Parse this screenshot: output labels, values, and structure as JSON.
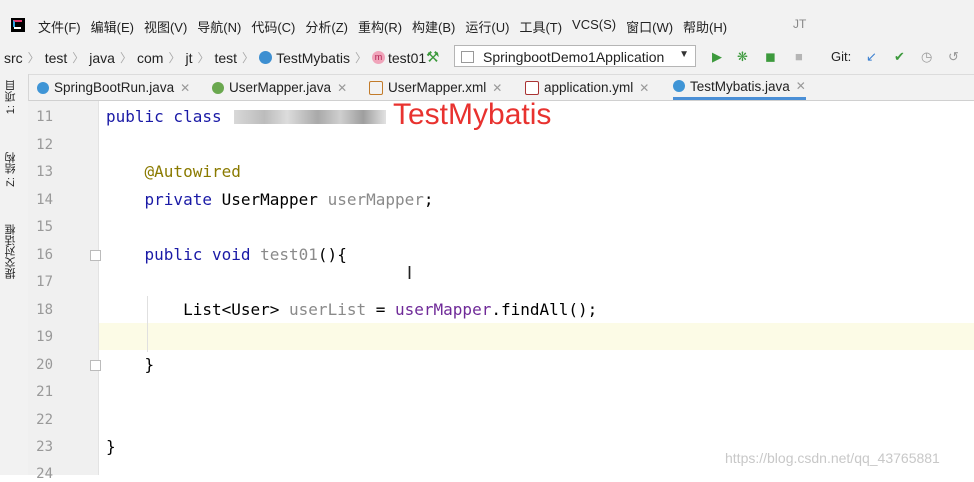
{
  "menu": {
    "items": [
      "文件(F)",
      "编辑(E)",
      "视图(V)",
      "导航(N)",
      "代码(C)",
      "分析(Z)",
      "重构(R)",
      "构建(B)",
      "运行(U)",
      "工具(T)",
      "VCS(S)",
      "窗口(W)",
      "帮助(H)"
    ],
    "user": "JT"
  },
  "breadcrumbs": [
    "src",
    "test",
    "java",
    "com",
    "jt",
    "test",
    "TestMybatis",
    "test01"
  ],
  "run_config": "SpringbootDemo1Application",
  "git_label": "Git:",
  "tabs": [
    "SpringBootRun.java",
    "UserMapper.java",
    "UserMapper.xml",
    "application.yml",
    "TestMybatis.java"
  ],
  "active_tab": "TestMybatis.java",
  "tool_windows": [
    "1: 项目",
    "Z: 结构",
    "提交对话框"
  ],
  "line_numbers": [
    "11",
    "12",
    "13",
    "14",
    "15",
    "16",
    "17",
    "18",
    "19",
    "20",
    "21",
    "22",
    "23",
    "24"
  ],
  "code": {
    "l11_kw": "public class",
    "l13_anno": "@Autowired",
    "l14_kw": "private ",
    "l14_type": "UserMapper ",
    "l14_field": "userMapper",
    "l14_end": ";",
    "l16_kw": "public void ",
    "l16_name": "test01",
    "l16_end": "(){",
    "l18_type": "List<User> ",
    "l18_var": "userList",
    "l18_eq": " = ",
    "l18_field": "userMapper",
    "l18_call": ".findAll();",
    "l20": "}",
    "l23": "}"
  },
  "annotation": "TestMybatis",
  "watermark": "https://blog.csdn.net/qq_43765881",
  "colors": {
    "keyword": "#1a1aa6",
    "annotation_text": "#8a7a00",
    "field": "#6f2a98",
    "annotation_overlay": "#e8322f"
  },
  "icons": [
    "intellij-logo-icon",
    "class-icon",
    "method-icon",
    "hammer-icon",
    "run-icon",
    "debug-icon",
    "coverage-icon",
    "stop-icon",
    "git-update-icon",
    "git-commit-icon",
    "history-icon",
    "rollback-icon"
  ]
}
